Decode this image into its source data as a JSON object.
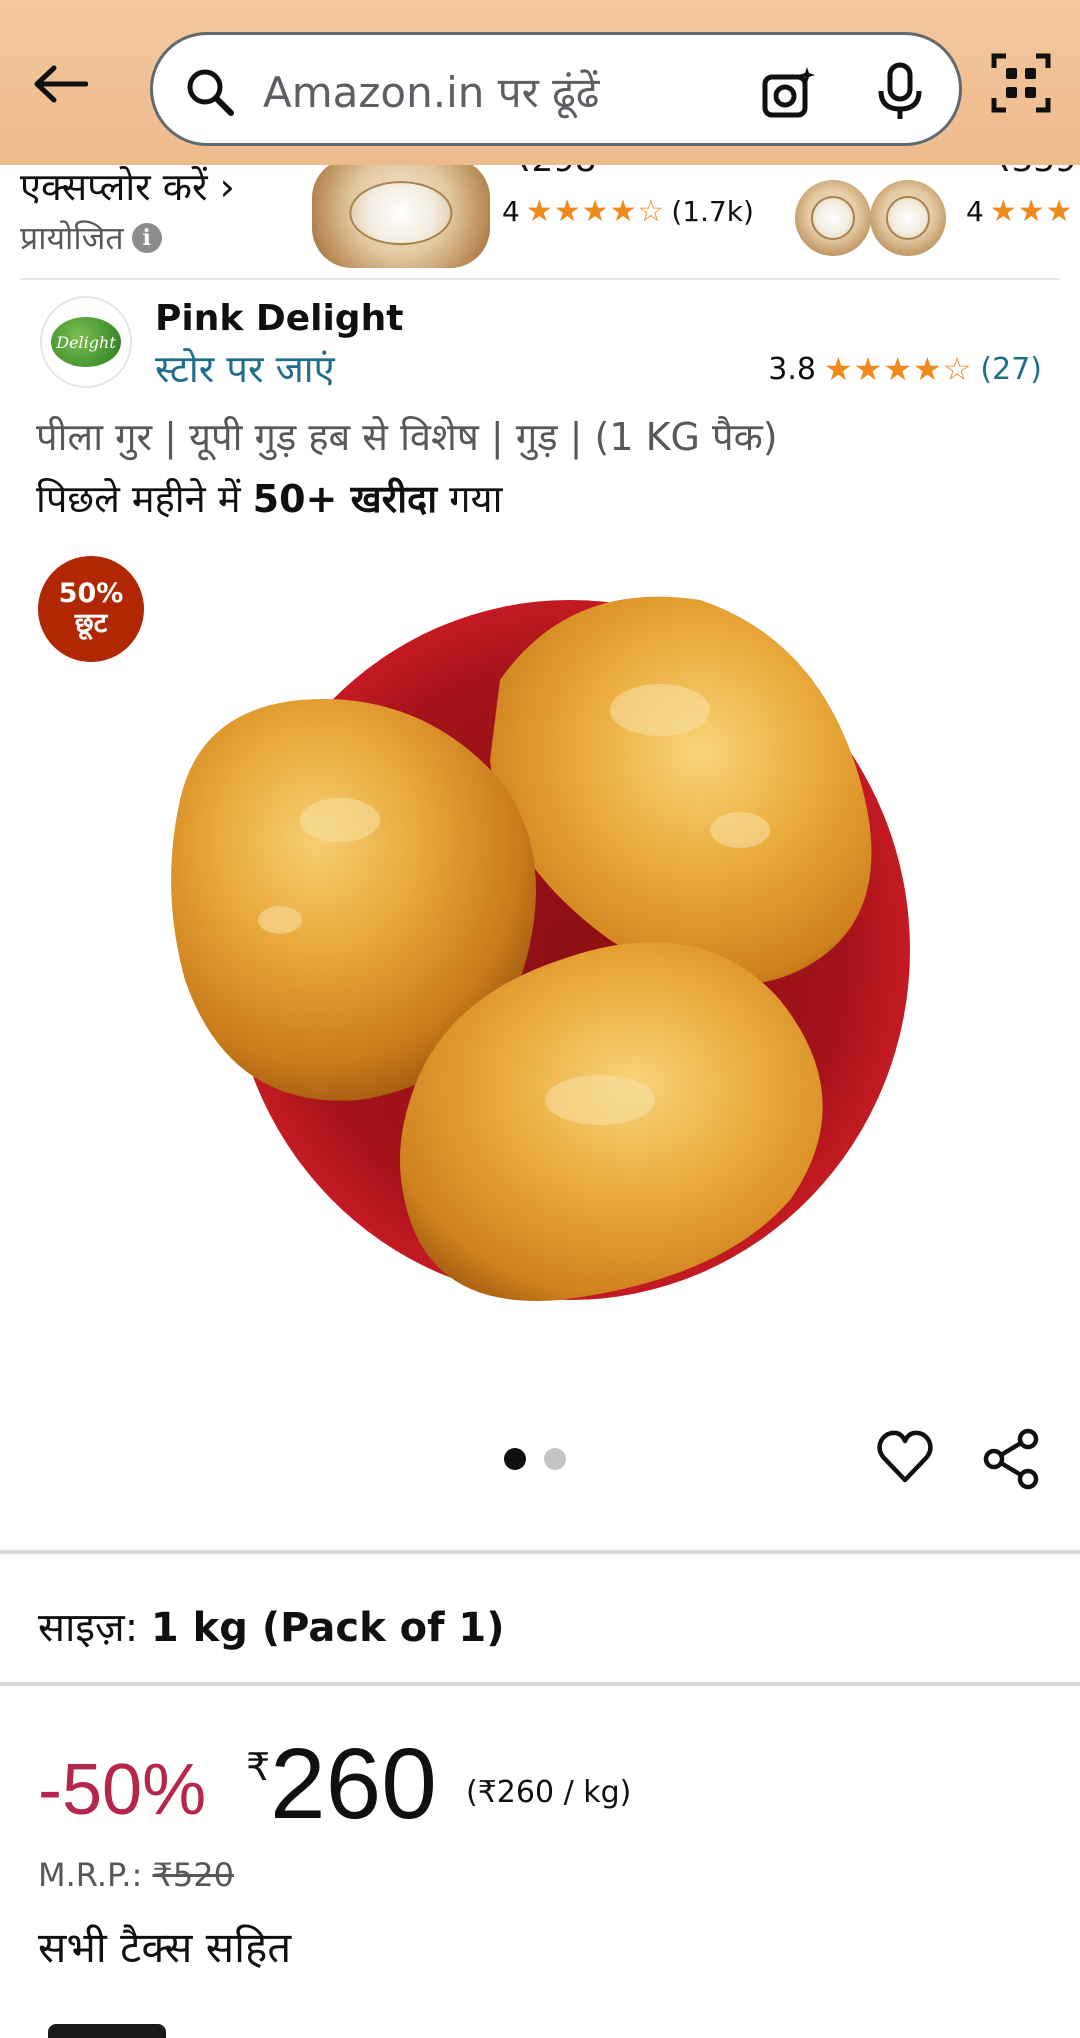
{
  "header": {
    "search_placeholder": "Amazon.in पर ढूंढें"
  },
  "sponsored": {
    "explore_text": "एक्सप्लोर करें ›",
    "label": "प्रायोजित",
    "items": [
      {
        "price_partial": "₹298",
        "rating_value": "4",
        "stars": "★★★★☆",
        "rating_count": "(1.7k)"
      },
      {
        "price_partial": "₹339",
        "rating_value": "4",
        "stars": "★★★"
      }
    ]
  },
  "brand": {
    "name": "Pink Delight",
    "store_link": "स्टोर पर जाएं",
    "logo_text": "Delight",
    "rating_value": "3.8",
    "stars": "★★★★☆",
    "rating_count": "(27)"
  },
  "product": {
    "title": "पीला गुर | यूपी गुड़ हब से विशेष | गुड़ | (1 KG पैक)",
    "bought_prefix": "पिछले महीने में ",
    "bought_bold": "50+ खरीदा",
    "bought_suffix": " गया",
    "badge_line1": "50%",
    "badge_line2": "छूट",
    "image_dots_total": 2,
    "image_dot_active": 1
  },
  "size": {
    "label": "साइज़:",
    "value": "1 kg (Pack of 1)"
  },
  "price": {
    "discount": "-50%",
    "currency": "₹",
    "amount": "260",
    "per_unit": "(₹260 / kg)",
    "mrp_label": "M.R.P.:",
    "mrp_value": "₹520",
    "tax_note": "सभी टैक्स सहित"
  },
  "colors": {
    "header_bg": "#f0c194",
    "badge_bg": "#b12704",
    "discount": "#b5264c",
    "link": "#1f6e8a",
    "star": "#f08a1c"
  }
}
